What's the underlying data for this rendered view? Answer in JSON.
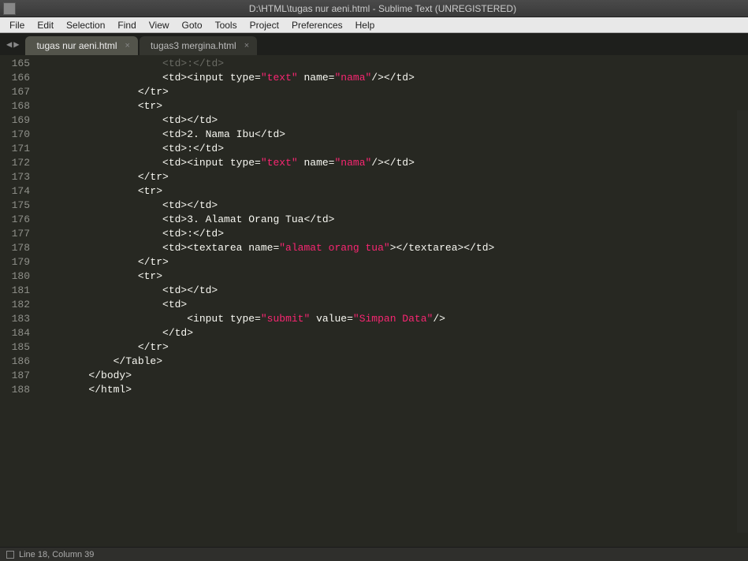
{
  "window": {
    "title": "D:\\HTML\\tugas nur aeni.html - Sublime Text (UNREGISTERED)"
  },
  "menu": {
    "items": [
      "File",
      "Edit",
      "Selection",
      "Find",
      "View",
      "Goto",
      "Tools",
      "Project",
      "Preferences",
      "Help"
    ]
  },
  "tabs": [
    {
      "label": "tugas nur aeni.html",
      "active": true
    },
    {
      "label": "tugas3 mergina.html",
      "active": false
    }
  ],
  "gutter": {
    "start": 165,
    "end": 188
  },
  "code_lines": [
    {
      "n": 165,
      "indent": 5,
      "html": "<span class='faded-top'>&lt;td&gt;:&lt;/td&gt;</span>"
    },
    {
      "n": 166,
      "indent": 5,
      "html": "&lt;td&gt;&lt;input type=<span class='sr'>\"text\"</span> name=<span class='sr'>\"nama\"</span>/&gt;&lt;/td&gt;"
    },
    {
      "n": 167,
      "indent": 4,
      "html": "&lt;/tr&gt;"
    },
    {
      "n": 168,
      "indent": 4,
      "html": "&lt;tr&gt;"
    },
    {
      "n": 169,
      "indent": 5,
      "html": "&lt;td&gt;&lt;/td&gt;"
    },
    {
      "n": 170,
      "indent": 5,
      "html": "&lt;td&gt;2. Nama Ibu&lt;/td&gt;"
    },
    {
      "n": 171,
      "indent": 5,
      "html": "&lt;td&gt;:&lt;/td&gt;"
    },
    {
      "n": 172,
      "indent": 5,
      "html": "&lt;td&gt;&lt;input type=<span class='sr'>\"text\"</span> name=<span class='sr'>\"nama\"</span>/&gt;&lt;/td&gt;"
    },
    {
      "n": 173,
      "indent": 4,
      "html": "&lt;/tr&gt;"
    },
    {
      "n": 174,
      "indent": 4,
      "html": "&lt;tr&gt;"
    },
    {
      "n": 175,
      "indent": 5,
      "html": "&lt;td&gt;&lt;/td&gt;"
    },
    {
      "n": 176,
      "indent": 5,
      "html": "&lt;td&gt;3. Alamat Orang Tua&lt;/td&gt;"
    },
    {
      "n": 177,
      "indent": 5,
      "html": "&lt;td&gt;:&lt;/td&gt;"
    },
    {
      "n": 178,
      "indent": 5,
      "html": "&lt;td&gt;&lt;textarea name=<span class='sr'>\"alamat orang tua\"</span>&gt;&lt;/textarea&gt;&lt;/td&gt;"
    },
    {
      "n": 179,
      "indent": 4,
      "html": "&lt;/tr&gt;"
    },
    {
      "n": 180,
      "indent": 4,
      "html": "&lt;tr&gt;"
    },
    {
      "n": 181,
      "indent": 5,
      "html": "&lt;td&gt;&lt;/td&gt;"
    },
    {
      "n": 182,
      "indent": 5,
      "html": "&lt;td&gt;"
    },
    {
      "n": 183,
      "indent": 6,
      "html": "&lt;input type=<span class='sr'>\"submit\"</span> value=<span class='sr'>\"Simpan Data\"</span>/&gt;"
    },
    {
      "n": 184,
      "indent": 5,
      "html": "&lt;/td&gt;"
    },
    {
      "n": 185,
      "indent": 4,
      "html": "&lt;/tr&gt;"
    },
    {
      "n": 186,
      "indent": 3,
      "html": "&lt;/Table&gt;"
    },
    {
      "n": 187,
      "indent": 2,
      "html": "&lt;/body&gt;"
    },
    {
      "n": 188,
      "indent": 2,
      "html": "&lt;/html&gt;"
    }
  ],
  "status": {
    "text": "Line 18, Column 39"
  }
}
